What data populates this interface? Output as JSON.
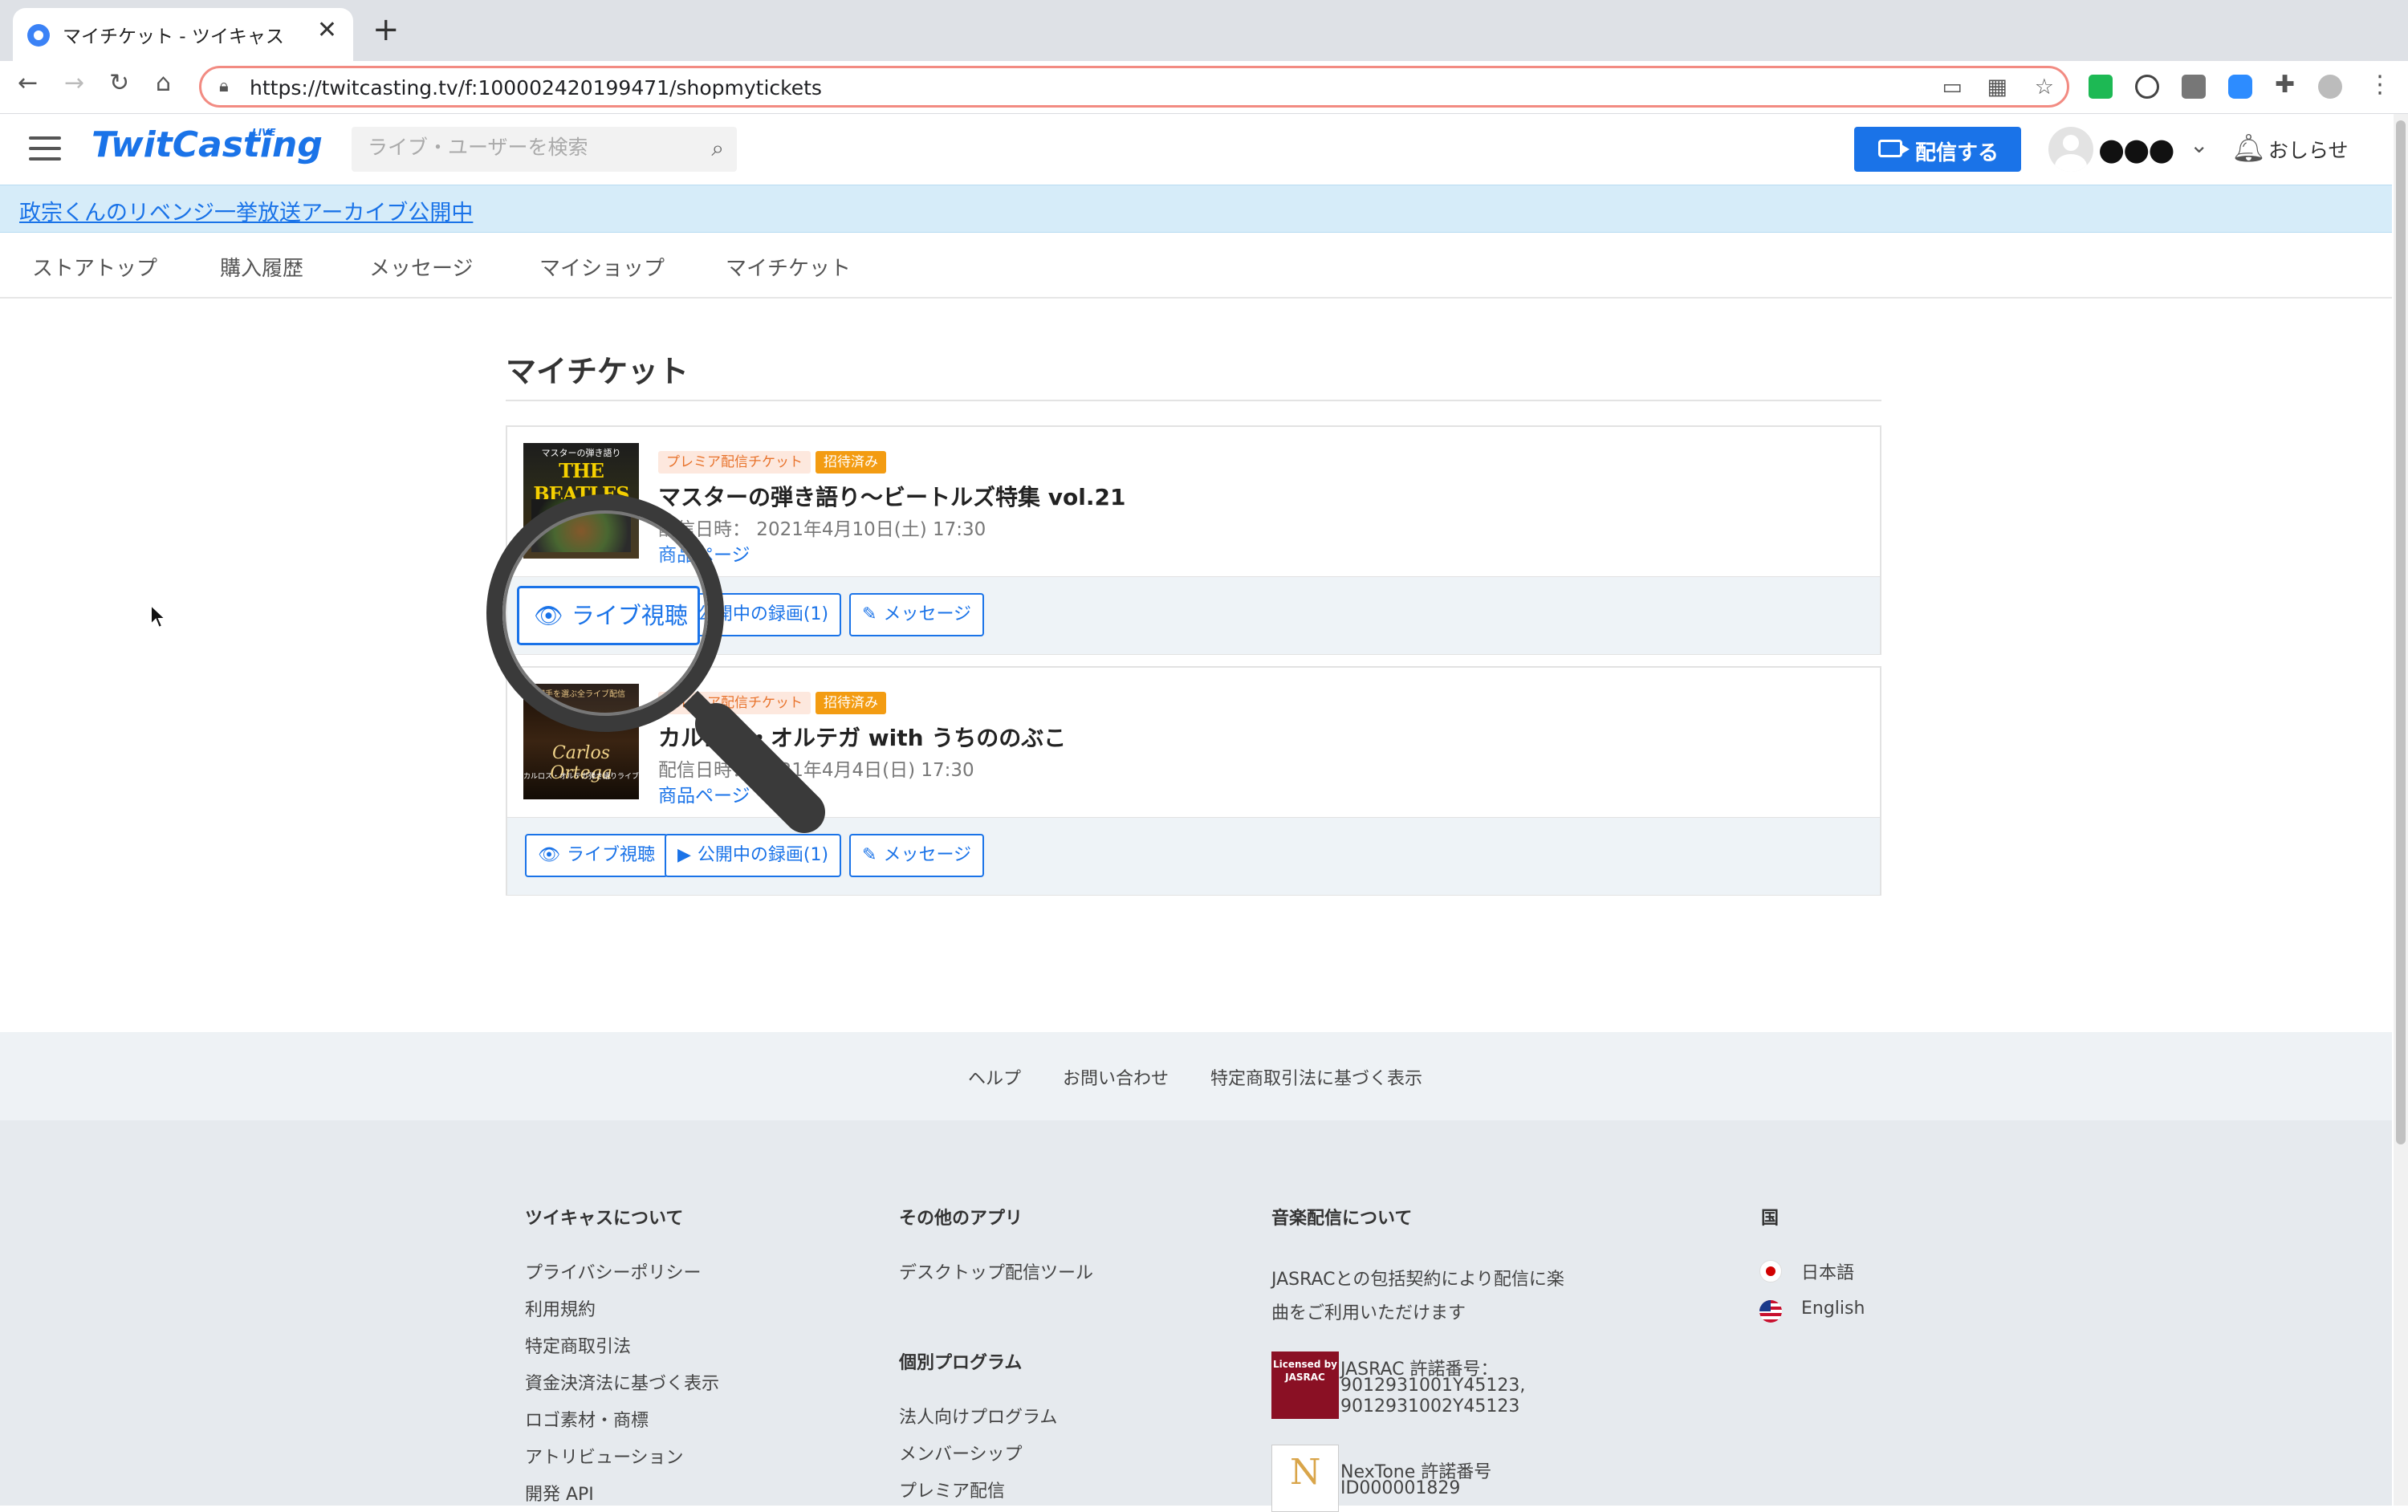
{
  "browser": {
    "tab_title": "マイチケット - ツイキャス",
    "url": "https://twitcasting.tv/f:100002420199471/shopmytickets"
  },
  "header": {
    "logo": "TwitCasting",
    "logo_badge": "LIVE",
    "search_placeholder": "ライブ・ユーザーを検索",
    "broadcast_button": "配信する",
    "username": "●●●",
    "notifications": "おしらせ"
  },
  "banner": {
    "text": "政宗くんのリベンジ一挙放送アーカイブ公開中"
  },
  "subnav": {
    "items": [
      "ストアトップ",
      "購入履歴",
      "メッセージ",
      "マイショップ",
      "マイチケット"
    ]
  },
  "main": {
    "heading": "マイチケット",
    "tickets": [
      {
        "badge_type": "プレミア配信チケット",
        "badge_status": "招待済み",
        "title": "マスターの弾き語り～ビートルズ特集 vol.21",
        "date": "配信日時： 2021年4月10日(土) 17:30",
        "product_link": "商品ページ",
        "thumb_caption": "マスターの弾き語り",
        "thumb_title": "THE BEATLES",
        "actions": {
          "live": "ライブ視聴",
          "recording": "公開中の録画(1)",
          "message": "メッセージ"
        }
      },
      {
        "badge_type": "プレミア配信チケット",
        "badge_status": "招待済み",
        "title": "カルロス・オルテガ with うちののぶこ",
        "date": "配信日時： 2021年4月4日(日) 17:30",
        "product_link": "商品ページ",
        "thumb_caption": "相手を選ぶ全ライブ配信",
        "thumb_title": "Carlos Ortega",
        "thumb_subtitle": "カルロス・オルテガ弾き語りライブ",
        "actions": {
          "live": "ライブ視聴",
          "recording": "公開中の録画(1)",
          "message": "メッセージ"
        }
      }
    ]
  },
  "footer": {
    "top_links": [
      "ヘルプ",
      "お問い合わせ",
      "特定商取引法に基づく表示"
    ],
    "about": {
      "title": "ツイキャスについて",
      "items": [
        "プライバシーポリシー",
        "利用規約",
        "特定商取引法",
        "資金決済法に基づく表示",
        "ロゴ素材・商標",
        "アトリビューション",
        "開発 API"
      ]
    },
    "apps": {
      "title": "その他のアプリ",
      "items": [
        "デスクトップ配信ツール"
      ]
    },
    "programs": {
      "title": "個別プログラム",
      "items": [
        "法人向けプログラム",
        "メンバーシップ",
        "プレミア配信"
      ]
    },
    "music": {
      "title": "音楽配信について",
      "line1": "JASRACとの包括契約により配信に楽",
      "line2": "曲をご利用いただけます",
      "jasrac_logo_text": "Licensed by JASRAC",
      "jasrac_label": "JASRAC 許諾番号：",
      "jasrac_no1": "9012931001Y45123,",
      "jasrac_no2": "9012931002Y45123",
      "nextone_label": "NexTone 許諾番号",
      "nextone_no": "ID000001829"
    },
    "country": {
      "title": "国",
      "languages": [
        "日本語",
        "English"
      ]
    }
  },
  "colors": {
    "brand": "#1a73e8",
    "banner_bg": "#d6ecf9",
    "badge_premium": "#e8732c",
    "badge_invited": "#f39c12"
  }
}
